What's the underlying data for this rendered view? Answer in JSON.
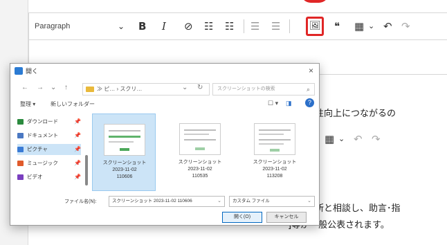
{
  "editor": {
    "paragraph_label": "Paragraph",
    "icons": {
      "caret": "⌄",
      "bold": "B",
      "italic": "I",
      "link": "⊘",
      "bullet_list": "☷",
      "numbered_list": "☷",
      "outdent": "☰",
      "indent": "☰",
      "image": "🖼",
      "quote": "❝",
      "table": "▦",
      "table_caret": "⌄",
      "undo": "↶",
      "redo": "↷"
    },
    "body_lines": [
      "に生産性向上につながるの",
      "工会議所と相談し、助言･指",
      "]等が一般公表されます。"
    ],
    "highlight_color": "#e02626"
  },
  "dialog": {
    "title": "開く",
    "close": "×",
    "nav": {
      "back": "←",
      "forward": "→",
      "down": "⌄",
      "up": "↑"
    },
    "address": "≫ ピ… › スクリ…",
    "address_caret": "⌄",
    "refresh": "↻",
    "search_placeholder": "スクリーンショットの検索",
    "search_icon": "⌕",
    "organize": "整理 ▾",
    "new_folder": "新しいフォルダー",
    "view_options": "☐ ▾",
    "panel_toggle": "◨",
    "help": "?",
    "sidebar": [
      {
        "label": "ダウンロード",
        "icon_color": "#2b8a3e",
        "pin": "📌"
      },
      {
        "label": "ドキュメント",
        "icon_color": "#4a78c2",
        "pin": "📌"
      },
      {
        "label": "ピクチャ",
        "icon_color": "#3a7bd5",
        "pin": "📌",
        "selected": true
      },
      {
        "label": "ミュージック",
        "icon_color": "#e05a2b",
        "pin": "📌"
      },
      {
        "label": "ビデオ",
        "icon_color": "#7a3fbf",
        "pin": "📌"
      }
    ],
    "files": [
      {
        "name": [
          "スクリーンショット",
          "2023-11-02",
          "110606"
        ],
        "selected": true
      },
      {
        "name": [
          "スクリーンショット",
          "2023-11-02",
          "110535"
        ],
        "selected": false
      },
      {
        "name": [
          "スクリーンショット",
          "2023-11-02",
          "113208"
        ],
        "selected": false
      }
    ],
    "filename_label": "ファイル名(N):",
    "filename_value": "スクリーンショット 2023-11-02 110606",
    "filename_caret": "⌄",
    "filetype": "カスタム ファイル",
    "filetype_caret": "⌄",
    "open_button": "開く(O)",
    "cancel_button": "キャンセル"
  }
}
